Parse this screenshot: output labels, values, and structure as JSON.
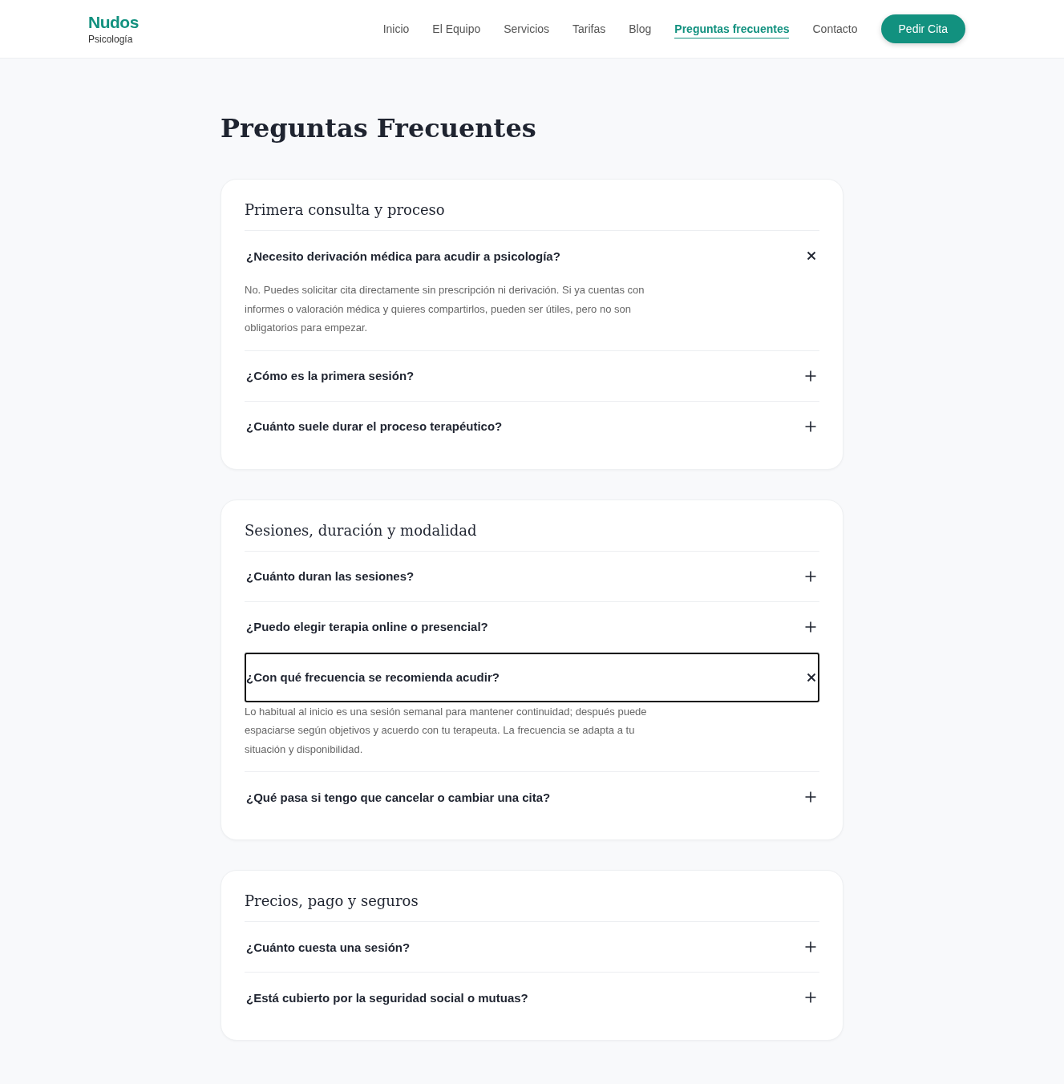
{
  "brand": {
    "name": "Nudos",
    "tagline": "Psicología"
  },
  "nav": [
    {
      "label": "Inicio",
      "selected": false
    },
    {
      "label": "El Equipo",
      "selected": false
    },
    {
      "label": "Servicios",
      "selected": false
    },
    {
      "label": "Tarifas",
      "selected": false
    },
    {
      "label": "Blog",
      "selected": false
    },
    {
      "label": "Preguntas frecuentes",
      "selected": true
    },
    {
      "label": "Contacto",
      "selected": false
    }
  ],
  "cta": "Pedir Cita",
  "title": "Preguntas Frecuentes",
  "sections": [
    {
      "heading": "Primera consulta y proceso",
      "items": [
        {
          "question": "¿Necesito derivación médica para acudir a psicología?",
          "expanded": true,
          "focused": false,
          "answer": "No. Puedes solicitar cita directamente sin prescripción ni derivación. Si ya cuentas con informes o valoración médica y quieres compartirlos, pueden ser útiles, pero no son obligatorios para empezar."
        },
        {
          "question": "¿Cómo es la primera sesión?",
          "expanded": false,
          "focused": false
        },
        {
          "question": "¿Cuánto suele durar el proceso terapéutico?",
          "expanded": false,
          "focused": false
        }
      ]
    },
    {
      "heading": "Sesiones, duración y modalidad",
      "items": [
        {
          "question": "¿Cuánto duran las sesiones?",
          "expanded": false,
          "focused": false
        },
        {
          "question": "¿Puedo elegir terapia online o presencial?",
          "expanded": false,
          "focused": false
        },
        {
          "question": "¿Con qué frecuencia se recomienda acudir?",
          "expanded": true,
          "focused": true,
          "answer": "Lo habitual al inicio es una sesión semanal para mantener continuidad; después puede espaciarse según objetivos y acuerdo con tu terapeuta. La frecuencia se adapta a tu situación y disponibilidad."
        },
        {
          "question": "¿Qué pasa si tengo que cancelar o cambiar una cita?",
          "expanded": false,
          "focused": false
        }
      ]
    },
    {
      "heading": "Precios, pago y seguros",
      "items": [
        {
          "question": "¿Cuánto cuesta una sesión?",
          "expanded": false,
          "focused": false
        },
        {
          "question": "¿Está cubierto por la seguridad social o mutuas?",
          "expanded": false,
          "focused": false
        }
      ]
    }
  ]
}
